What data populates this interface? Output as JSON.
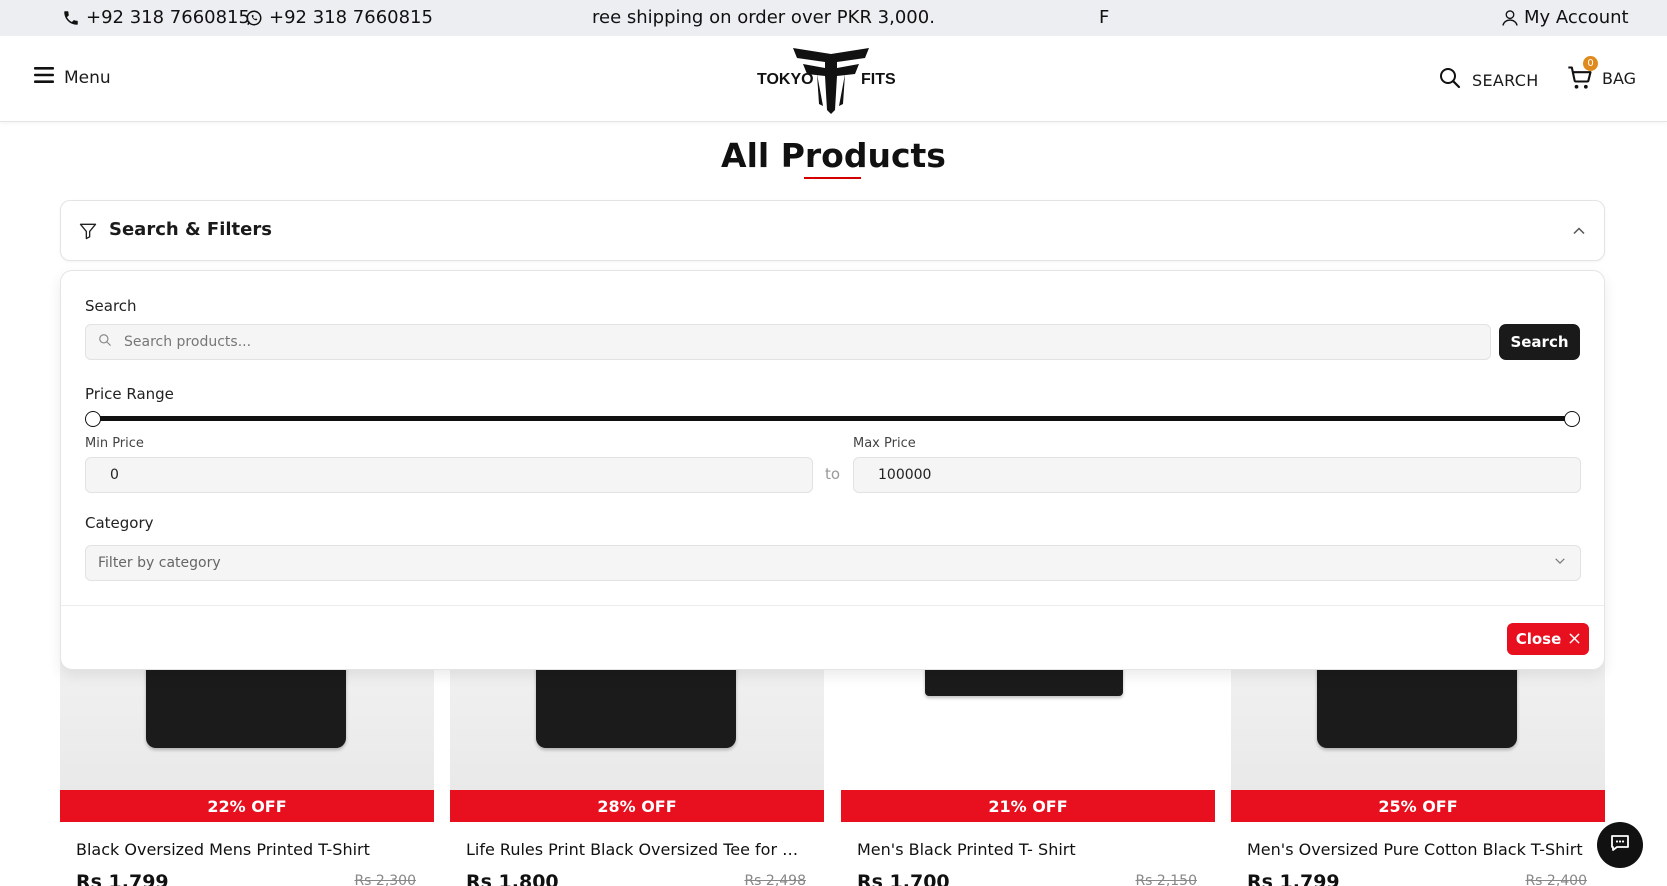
{
  "topbar": {
    "phone": "+92 318 7660815",
    "whatsapp": "+92 318 7660815",
    "promo": "ree shipping on order over PKR 3,000.",
    "promo_tail": "F",
    "account_label": "My Account"
  },
  "header": {
    "menu_label": "Menu",
    "logo_text_left": "TOKYO",
    "logo_text_right": "FITS",
    "search_label": "SEARCH",
    "bag_label": "BAG",
    "bag_count": "0"
  },
  "page": {
    "title": "All Products"
  },
  "filters": {
    "title": "Search & Filters",
    "search_label": "Search",
    "search_placeholder": "Search products...",
    "search_button": "Search",
    "price_range_label": "Price Range",
    "min_price_label": "Min Price",
    "max_price_label": "Max Price",
    "min_price_value": "0",
    "max_price_value": "100000",
    "to_label": "to",
    "category_label": "Category",
    "category_placeholder": "Filter by category",
    "close_button": "Close"
  },
  "products": [
    {
      "discount": "22% OFF",
      "name": "Black Oversized Mens Printed T-Shirt",
      "price": "Rs 1,799",
      "old_price": "Rs 2,300"
    },
    {
      "discount": "28% OFF",
      "name": "Life Rules Print Black Oversized Tee for Me...",
      "price": "Rs 1,800",
      "old_price": "Rs 2,498"
    },
    {
      "discount": "21% OFF",
      "name": "Men's Black Printed T- Shirt",
      "price": "Rs 1,700",
      "old_price": "Rs 2,150"
    },
    {
      "discount": "25% OFF",
      "name": "Men's Oversized Pure Cotton Black T-Shirt",
      "price": "Rs 1,799",
      "old_price": "Rs 2,400"
    }
  ],
  "colors": {
    "accent_red": "#e8101e",
    "dark": "#1a1a1a",
    "badge_orange": "#e08a1e"
  }
}
